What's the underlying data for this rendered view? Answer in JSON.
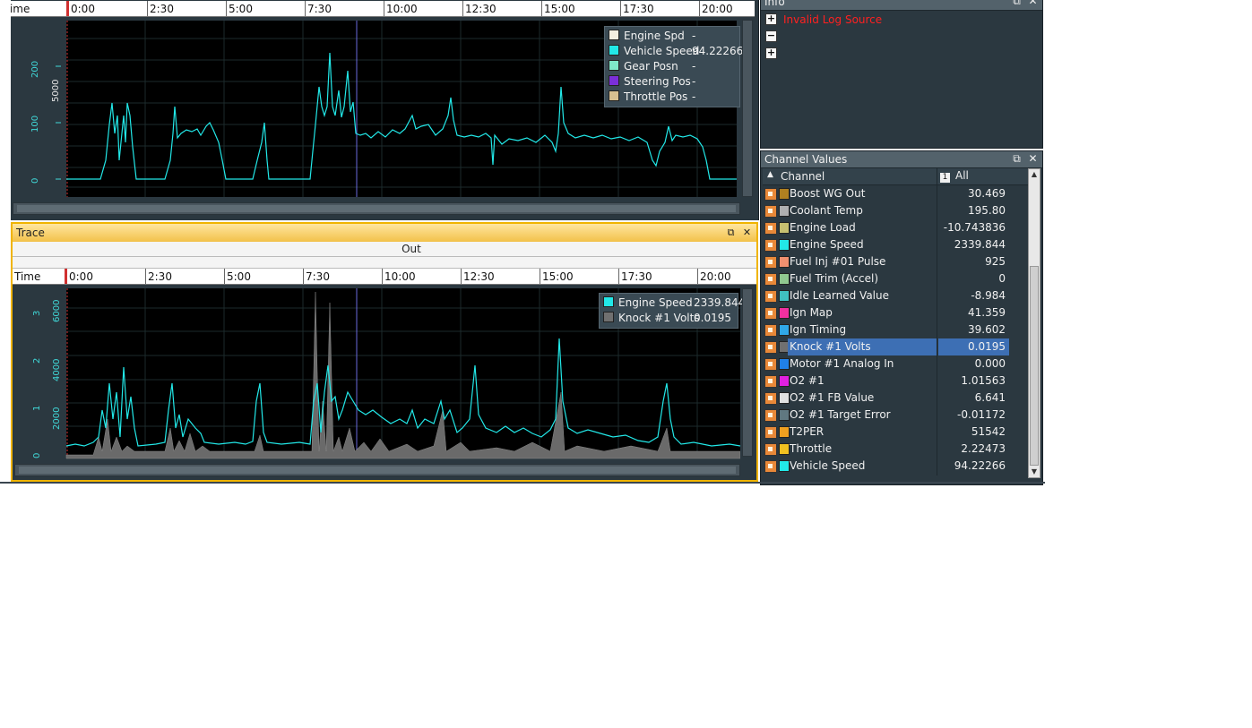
{
  "time_axis": {
    "label": "Time",
    "ticks": [
      "0:00",
      "2:30",
      "5:00",
      "7:30",
      "10:00",
      "12:30",
      "15:00",
      "17:30",
      "20:00"
    ]
  },
  "top_chart": {
    "y_labels_a": [
      "0",
      "100",
      "200"
    ],
    "y_label_b": "5000",
    "legend": [
      {
        "name": "Engine Spd",
        "value": "-",
        "color": "#f5efe0"
      },
      {
        "name": "Vehicle Speed",
        "value": "94.22266",
        "color": "#22e8e8"
      },
      {
        "name": "Gear Posn",
        "value": "-",
        "color": "#7fe8c8"
      },
      {
        "name": "Steering Pos",
        "value": "-",
        "color": "#7b2fd8"
      },
      {
        "name": "Throttle Pos",
        "value": "-",
        "color": "#d8c090"
      }
    ]
  },
  "bottom_chart": {
    "panel_title": "Trace",
    "out_label": "Out",
    "y_labels_a": [
      "0",
      "1",
      "2",
      "3"
    ],
    "y_labels_b": [
      "2000",
      "4000",
      "6000"
    ],
    "legend": [
      {
        "name": "Engine Speed",
        "value": "2339.844",
        "color": "#22e8e8"
      },
      {
        "name": "Knock #1 Volts",
        "value": "0.0195",
        "color": "#707070"
      }
    ]
  },
  "info_panel": {
    "title": "Info",
    "error": "Invalid Log Source",
    "tree_buttons": [
      "+",
      "−",
      "+"
    ]
  },
  "channel_panel": {
    "title": "Channel Values",
    "col_channel": "Channel",
    "col_badge": "1",
    "col_all": "All",
    "rows": [
      {
        "name": "Boost WG Out",
        "value": "30.469",
        "color": "#b08020"
      },
      {
        "name": "Coolant Temp",
        "value": "195.80",
        "color": "#b0b0b0"
      },
      {
        "name": "Engine Load",
        "value": "-10.743836",
        "color": "#c8c070"
      },
      {
        "name": "Engine Speed",
        "value": "2339.844",
        "color": "#22e8e8"
      },
      {
        "name": "Fuel Inj #01 Pulse",
        "value": "925",
        "color": "#f09070"
      },
      {
        "name": "Fuel Trim (Accel)",
        "value": "0",
        "color": "#90c890"
      },
      {
        "name": "Idle Learned Value",
        "value": "-8.984",
        "color": "#40c0c0"
      },
      {
        "name": "Ign Map",
        "value": "41.359",
        "color": "#f030a0"
      },
      {
        "name": "Ign Timing",
        "value": "39.602",
        "color": "#30a8e8"
      },
      {
        "name": "Knock #1 Volts",
        "value": "0.0195",
        "color": "#707070",
        "selected": true
      },
      {
        "name": "Motor #1 Analog In",
        "value": "0.000",
        "color": "#2080e8"
      },
      {
        "name": "O2 #1",
        "value": "1.01563",
        "color": "#e020e0"
      },
      {
        "name": "O2 #1 FB Value",
        "value": "6.641",
        "color": "#e0e0e0"
      },
      {
        "name": "O2 #1 Target Error",
        "value": "-0.01172",
        "color": "#607880"
      },
      {
        "name": "T2PER",
        "value": "51542",
        "color": "#f0a020"
      },
      {
        "name": "Throttle",
        "value": "2.22473",
        "color": "#f0c020"
      },
      {
        "name": "Vehicle Speed",
        "value": "94.22266",
        "color": "#22e8e8"
      }
    ]
  },
  "colors": {
    "panel_bg": "#2b3840",
    "plot_bg": "#000000",
    "trace_cyan": "#22e8e8",
    "trace_grey": "#707070",
    "trace_border": "#f0b400",
    "selected_row": "#3d6fb4",
    "error_text": "#ff2020"
  }
}
